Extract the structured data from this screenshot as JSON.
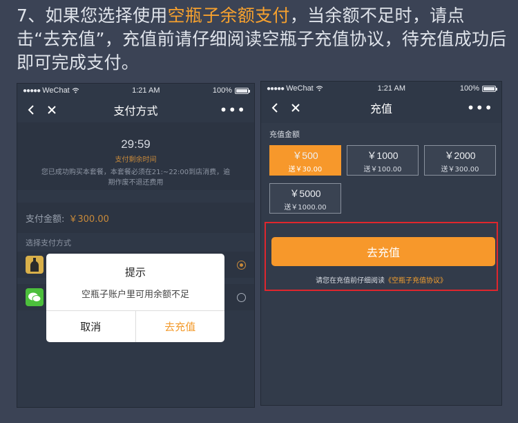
{
  "instruction": {
    "text_before": "7、如果您选择使用",
    "highlight": "空瓶子余额支付",
    "text_after": "，当余额不足时，请点击“去充值”，充值前请仔细阅读空瓶子充值协议，待充值成功后即可完成支付。"
  },
  "status_bar": {
    "carrier": "WeChat",
    "time": "1:21 AM",
    "battery": "100%"
  },
  "phone1": {
    "nav_title": "支付方式",
    "more": "•••",
    "timer": "29:59",
    "timer_label": "支付剩余时间",
    "notice": "您已成功购买本套餐，本套餐必须在21:~22:00到店消费，逾期作废不退还费用",
    "pay_label": "支付金额:",
    "pay_amount": "￥300.00",
    "section_label": "选择支付方式",
    "dialog": {
      "title": "提示",
      "message": "空瓶子账户里可用余额不足",
      "cancel": "取消",
      "confirm": "去充值"
    }
  },
  "phone2": {
    "nav_title": "充值",
    "more": "•••",
    "amount_label": "充值金额",
    "options": [
      {
        "value": "￥500",
        "gift": "送￥30.00",
        "selected": true
      },
      {
        "value": "￥1000",
        "gift": "送￥100.00",
        "selected": false
      },
      {
        "value": "￥2000",
        "gift": "送￥300.00",
        "selected": false
      },
      {
        "value": "￥5000",
        "gift": "送￥1000.00",
        "selected": false
      }
    ],
    "recharge_button": "去充值",
    "agreement_text": "请您在充值前仔细阅读",
    "agreement_link": "《空瓶子充值协议》"
  },
  "colors": {
    "background": "#3b4355",
    "accent": "#f7982b",
    "highlight_box": "#e0262d"
  }
}
